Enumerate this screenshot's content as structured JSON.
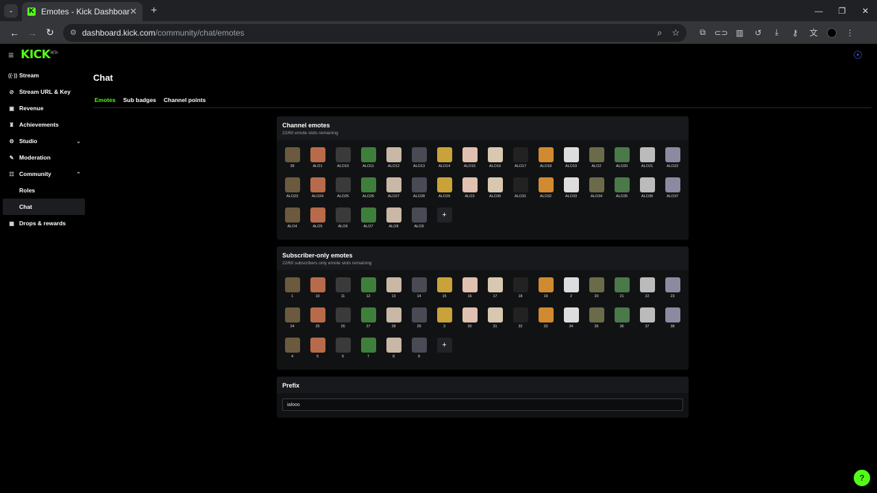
{
  "browser": {
    "tab_title": "Emotes - Kick Dashboard",
    "url_host": "dashboard.kick.com",
    "url_path": "/community/chat/emotes"
  },
  "sidebar": {
    "logo": "KICK",
    "items": [
      {
        "label": "Stream",
        "icon": "broadcast-icon"
      },
      {
        "label": "Stream URL & Key",
        "icon": "link-icon"
      },
      {
        "label": "Revenue",
        "icon": "revenue-icon"
      },
      {
        "label": "Achievements",
        "icon": "trophy-icon"
      },
      {
        "label": "Studio",
        "icon": "gear-icon"
      },
      {
        "label": "Moderation",
        "icon": "wrench-icon"
      },
      {
        "label": "Community",
        "icon": "community-icon"
      }
    ],
    "sub_items": [
      "Roles",
      "Chat"
    ],
    "last_item": {
      "label": "Drops & rewards",
      "icon": "gift-icon"
    }
  },
  "main": {
    "title": "Chat",
    "tabs": [
      "Emotes",
      "Sub badges",
      "Channel points"
    ]
  },
  "channel_emotes": {
    "title": "Channel emotes",
    "subtitle": "22/60 emote slots remaining",
    "emotes": [
      "39",
      "ALO1",
      "ALO10",
      "ALO11",
      "ALO12",
      "ALO13",
      "ALO14",
      "ALO15",
      "ALO16",
      "ALO17",
      "ALO18",
      "ALO19",
      "ALO2",
      "ALO20",
      "ALO21",
      "ALO22",
      "ALO23",
      "ALO24",
      "ALO25",
      "ALO26",
      "ALO27",
      "ALO28",
      "ALO29",
      "ALO3",
      "ALO30",
      "ALO31",
      "ALO32",
      "ALO33",
      "ALO34",
      "ALO35",
      "ALO36",
      "ALO37",
      "ALO4",
      "ALO5",
      "ALO6",
      "ALO7",
      "ALO8",
      "ALO9"
    ]
  },
  "sub_emotes": {
    "title": "Subscriber-only emotes",
    "subtitle": "22/60 subscribers only emote slots remaining",
    "emotes": [
      "1",
      "10",
      "11",
      "12",
      "13",
      "14",
      "15",
      "16",
      "17",
      "18",
      "19",
      "2",
      "20",
      "21",
      "22",
      "23",
      "24",
      "25",
      "26",
      "27",
      "28",
      "29",
      "3",
      "30",
      "31",
      "32",
      "33",
      "34",
      "35",
      "36",
      "37",
      "38",
      "4",
      "5",
      "6",
      "7",
      "8",
      "9"
    ]
  },
  "prefix": {
    "title": "Prefix",
    "value": "ialooo"
  },
  "emote_colors": [
    "#6b5a3e",
    "#b86b4a",
    "#3a3a3a",
    "#3f7f3c",
    "#c9b8a6",
    "#4a4a55",
    "#c9a33a",
    "#e0c0b0",
    "#d8c8b0",
    "#222",
    "#d08a30",
    "#ddd",
    "#6b6b4a",
    "#4a7a4a",
    "#bbb",
    "#8a8aa0"
  ]
}
